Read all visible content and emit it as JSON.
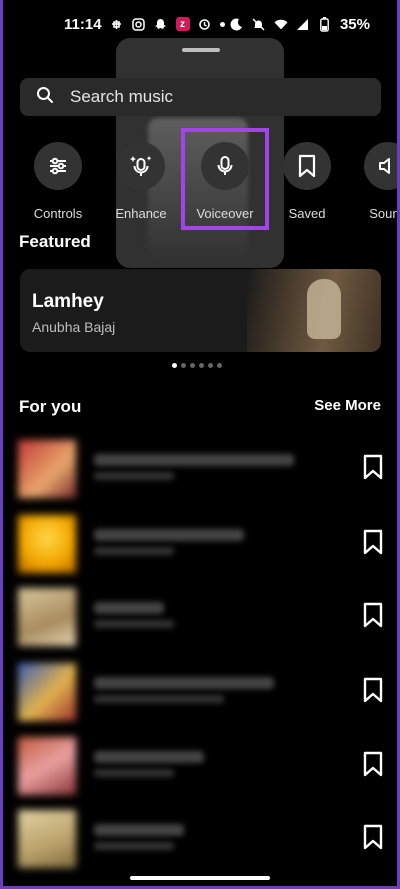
{
  "status_bar": {
    "time": "11:14",
    "battery": "35%"
  },
  "search": {
    "placeholder": "Search music"
  },
  "tools": [
    {
      "label": "Controls",
      "icon": "sliders-icon"
    },
    {
      "label": "Enhance",
      "icon": "sparkle-mic-icon"
    },
    {
      "label": "Voiceover",
      "icon": "microphone-icon"
    },
    {
      "label": "Saved",
      "icon": "bookmark-icon"
    },
    {
      "label": "Sound",
      "icon": "speaker-icon"
    }
  ],
  "featured": {
    "heading": "Featured",
    "title": "Lamhey",
    "artist": "Anubha Bajaj"
  },
  "for_you": {
    "heading": "For you",
    "see_more": "See More"
  },
  "colors": {
    "highlight": "#a244e8",
    "background": "#000000"
  }
}
